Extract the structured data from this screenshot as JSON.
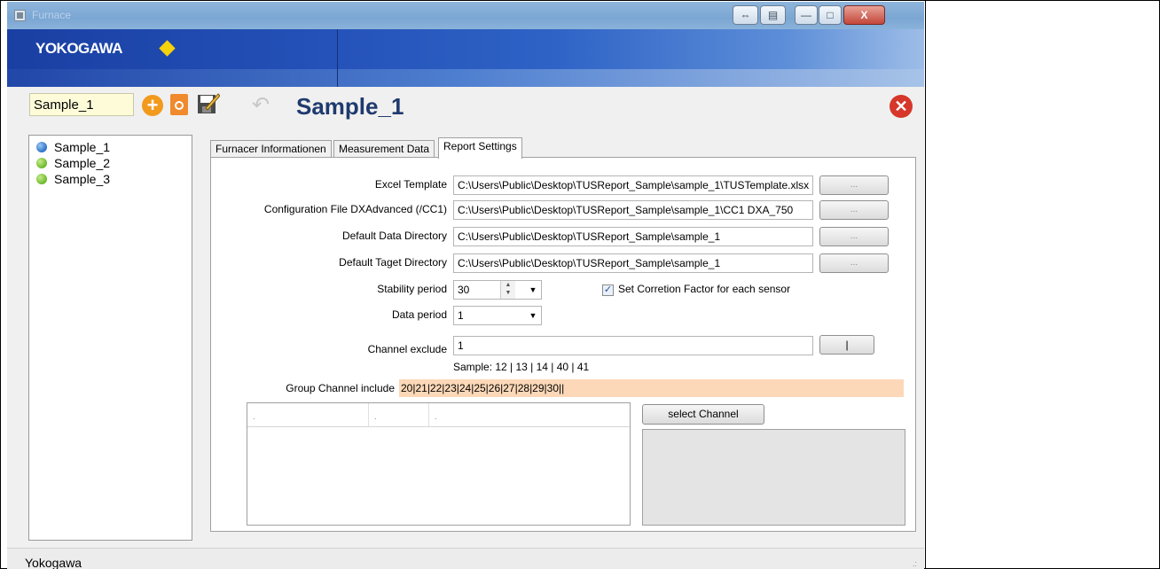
{
  "window": {
    "title": "Furnace",
    "controls": {
      "nav": "⇔",
      "menu": "▤",
      "minimize": "—",
      "maximize": "□",
      "close": "X"
    }
  },
  "brand": {
    "logo_text": "YOKOGAWA",
    "accent_color": "#f5d20a"
  },
  "toolbar": {
    "name_value": "Sample_1",
    "heading": "Sample_1",
    "add_glyph": "+",
    "undo_glyph": "↶",
    "close_glyph": "✕"
  },
  "samples": [
    {
      "label": "Sample_1",
      "status": "blue"
    },
    {
      "label": "Sample_2",
      "status": "green"
    },
    {
      "label": "Sample_3",
      "status": "green"
    }
  ],
  "tabs": [
    {
      "label": "Furnacer Informationen",
      "active": false
    },
    {
      "label": "Measurement Data",
      "active": false
    },
    {
      "label": "Report Settings",
      "active": true
    }
  ],
  "report": {
    "excel_template": {
      "label": "Excel Template",
      "value": "C:\\Users\\Public\\Desktop\\TUSReport_Sample\\sample_1\\TUSTemplate.xlsx",
      "button": "..."
    },
    "config_file": {
      "label": "Configuration File DXAdvanced (/CC1)",
      "value": "C:\\Users\\Public\\Desktop\\TUSReport_Sample\\sample_1\\CC1 DXA_750",
      "button": "..."
    },
    "data_dir": {
      "label": "Default Data Directory",
      "value": "C:\\Users\\Public\\Desktop\\TUSReport_Sample\\sample_1",
      "button": "..."
    },
    "target_dir": {
      "label": "Default Taget Directory",
      "value": "C:\\Users\\Public\\Desktop\\TUSReport_Sample\\sample_1",
      "button": "..."
    },
    "stability_period": {
      "label": "Stability period",
      "value": "30"
    },
    "data_period": {
      "label": "Data period",
      "value": "1"
    },
    "correction": {
      "label": "Set Corretion Factor for each sensor",
      "checked": true,
      "check_glyph": "✓"
    },
    "channel_exclude": {
      "label": "Channel exclude",
      "value": "1",
      "button": "|",
      "hint": "Sample: 12 | 13 | 14 | 40 | 41"
    },
    "group_channel": {
      "label": "Group Channel include",
      "value": "20|21|22|23|24|25|26|27|28|29|30||"
    },
    "grid_columns": [
      ".",
      ".",
      "."
    ],
    "select_channel_button": "select Channel"
  },
  "status": {
    "text": "Yokogawa",
    "grip": ".:"
  }
}
